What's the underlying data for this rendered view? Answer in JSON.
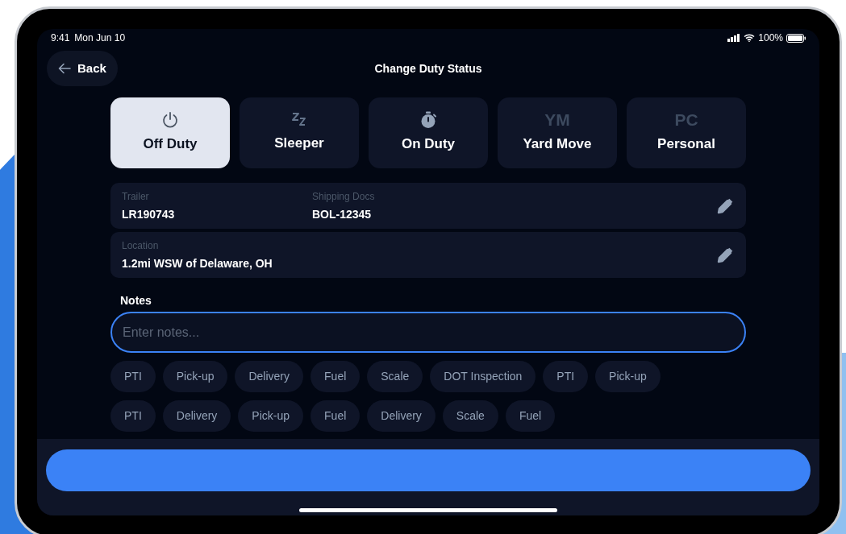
{
  "status_bar": {
    "time": "9:41",
    "date": "Mon Jun 10",
    "battery": "100%"
  },
  "header": {
    "back": "Back",
    "title": "Change Duty Status"
  },
  "duty_statuses": [
    {
      "label": "Off Duty",
      "kind": "power",
      "selected": true
    },
    {
      "label": "Sleeper",
      "kind": "sleep",
      "selected": false
    },
    {
      "label": "On Duty",
      "kind": "stopwatch",
      "selected": false
    },
    {
      "label": "Yard Move",
      "kind": "text",
      "icon_text": "YM",
      "selected": false
    },
    {
      "label": "Personal",
      "kind": "text",
      "icon_text": "PC",
      "selected": false
    }
  ],
  "info_cards": [
    {
      "fields": [
        {
          "label": "Trailer",
          "value": "LR190743"
        },
        {
          "label": "Shipping Docs",
          "value": "BOL-12345"
        }
      ]
    },
    {
      "fields": [
        {
          "label": "Location",
          "value": "1.2mi WSW of Delaware, OH"
        }
      ]
    }
  ],
  "notes": {
    "label": "Notes",
    "placeholder": "Enter notes..."
  },
  "quick_note_rows": [
    {
      "chips": [
        "PTI",
        "Pick-up",
        "Delivery",
        "Fuel",
        "Scale",
        "DOT Inspection",
        "PTI",
        "Pick-up"
      ]
    },
    {
      "chips": [
        "PTI",
        "Delivery",
        "Pick-up",
        "Fuel",
        "Delivery",
        "Scale",
        "Fuel"
      ]
    }
  ]
}
